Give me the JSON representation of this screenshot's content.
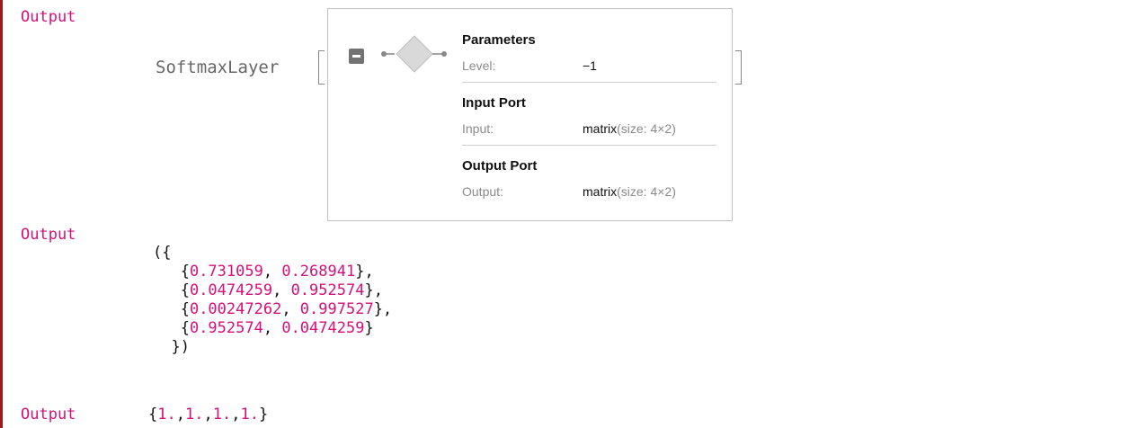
{
  "outputs": [
    {
      "label": "Output"
    },
    {
      "label": "Output"
    },
    {
      "label": "Output"
    }
  ],
  "layer": {
    "name": "SoftmaxLayer",
    "sections": {
      "parameters": "Parameters",
      "input": "Input Port",
      "output": "Output Port"
    },
    "params": [
      {
        "label": "Level:",
        "value": "−1"
      }
    ],
    "input": {
      "label": "Input:",
      "type": "matrix",
      "size": "(size: 4×2)"
    },
    "output": {
      "label": "Output:",
      "type": "matrix",
      "size": "(size: 4×2)"
    }
  },
  "matrix": {
    "open": "({",
    "close": "})",
    "rows": [
      [
        "0.731059",
        "0.268941"
      ],
      [
        "0.0474259",
        "0.952574"
      ],
      [
        "0.00247262",
        "0.997527"
      ],
      [
        "0.952574",
        "0.0474259"
      ]
    ]
  },
  "sums": [
    "1.",
    "1.",
    "1.",
    "1."
  ],
  "colors": {
    "accent": "#d4117a",
    "cell_bar": "#9b1b1b"
  },
  "icons": [
    "collapse-icon",
    "layer-graph-icon"
  ]
}
